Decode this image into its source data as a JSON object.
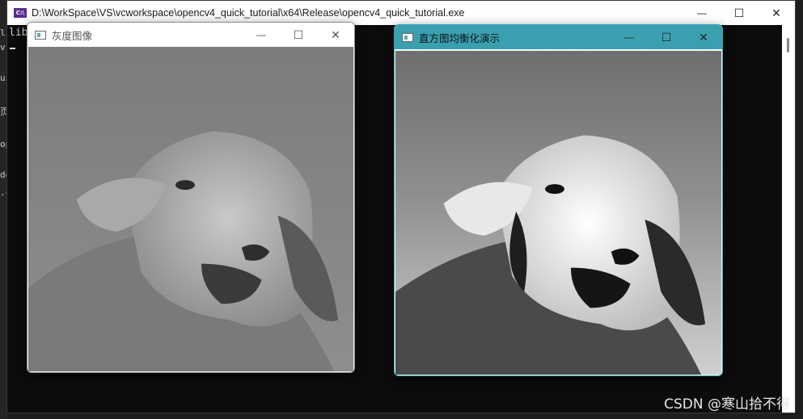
{
  "background_ide": {
    "fragments": [
      "lib",
      "v",
      "ui",
      "页",
      "op",
      "de",
      ".c"
    ]
  },
  "console": {
    "title": "D:\\WorkSpace\\VS\\vcworkspace\\opencv4_quick_tutorial\\x64\\Release\\opencv4_quick_tutorial.exe",
    "app_icon_text": "C:\\",
    "output_text": "lib",
    "minimize_glyph": "—",
    "maximize_glyph": "☐",
    "close_glyph": "✕"
  },
  "window_gray": {
    "title": "灰度图像",
    "minimize_glyph": "—",
    "maximize_glyph": "☐",
    "close_glyph": "✕"
  },
  "window_equalized": {
    "title": "直方图均衡化演示",
    "minimize_glyph": "—",
    "maximize_glyph": "☐",
    "close_glyph": "✕"
  },
  "watermark": "CSDN @寒山拾不得",
  "colors": {
    "console_bg": "#0c0c0c",
    "active_titlebar": "#3aa0b0",
    "inactive_titlebar": "#ffffff"
  }
}
